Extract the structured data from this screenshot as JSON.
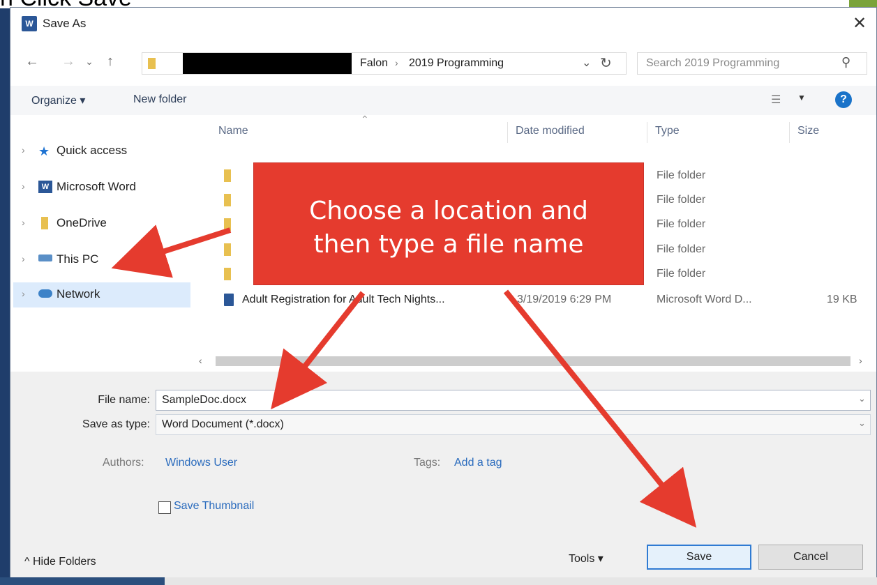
{
  "background_partial_title": "n Click Save",
  "dialog": {
    "title": "Save As",
    "close_glyph": "✕",
    "title_icon": "word-icon"
  },
  "nav": {
    "back": "←",
    "forward": "→",
    "recent": "⌄",
    "up": "↑",
    "breadcrumb": [
      "Falon",
      "2019 Programming"
    ],
    "breadcrumb_sep": "›",
    "search_placeholder": "Search 2019 Programming"
  },
  "toolbar": {
    "organize": "Organize ▾",
    "new_folder": "New folder",
    "help": "?"
  },
  "sidebar": {
    "items": [
      {
        "label": "Quick access",
        "icon": "star-icon"
      },
      {
        "label": "Microsoft Word",
        "icon": "word-icon"
      },
      {
        "label": "OneDrive",
        "icon": "cloud-folder-icon"
      },
      {
        "label": "This PC",
        "icon": "computer-icon"
      },
      {
        "label": "Network",
        "icon": "network-icon",
        "selected": true
      }
    ]
  },
  "columns": {
    "name": "Name",
    "date": "Date modified",
    "type": "Type",
    "size": "Size"
  },
  "files": [
    {
      "name": "",
      "date": "",
      "type": "File folder",
      "size": ""
    },
    {
      "name": "",
      "date": "",
      "type": "File folder",
      "size": ""
    },
    {
      "name": "",
      "date": "",
      "type": "File folder",
      "size": ""
    },
    {
      "name": "",
      "date": "",
      "type": "File folder",
      "size": ""
    },
    {
      "name": "",
      "date": "",
      "type": "File folder",
      "size": ""
    },
    {
      "name": "Adult Registration for Adult Tech Nights...",
      "date": "3/19/2019 6:29 PM",
      "type": "Microsoft Word D...",
      "size": "19 KB"
    }
  ],
  "form": {
    "file_name_label": "File name:",
    "file_name_value": "SampleDoc.docx",
    "save_type_label": "Save as type:",
    "save_type_value": "Word Document (*.docx)",
    "authors_label": "Authors:",
    "authors_value": "Windows User",
    "tags_label": "Tags:",
    "tags_value": "Add a tag",
    "thumbnail_label": "Save Thumbnail"
  },
  "footer": {
    "hide_folders": "^  Hide Folders",
    "tools": "Tools  ▾",
    "save": "Save",
    "cancel": "Cancel"
  },
  "callout": {
    "line1": "Choose a location and",
    "line2": "then type a file name",
    "color": "#e53b2e"
  }
}
